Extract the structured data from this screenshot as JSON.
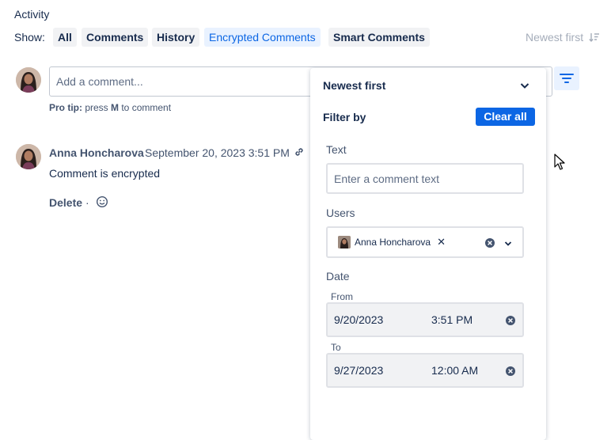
{
  "activity": {
    "heading": "Activity",
    "show_label": "Show:",
    "tabs": [
      {
        "label": "All",
        "active": false
      },
      {
        "label": "Comments",
        "active": false
      },
      {
        "label": "History",
        "active": false
      },
      {
        "label": "Encrypted Comments",
        "active": true
      },
      {
        "label": "Smart Comments",
        "active": false
      }
    ],
    "sort_label": "Newest first"
  },
  "composer": {
    "placeholder": "Add a comment...",
    "protip_prefix": "Pro tip:",
    "protip_mid": " press ",
    "protip_key": "M",
    "protip_suffix": " to comment"
  },
  "comment": {
    "author": "Anna Honcharova",
    "date": "September 20, 2023 3:51 PM",
    "body": "Comment is encrypted",
    "delete_label": "Delete",
    "separator": "·"
  },
  "filter_panel": {
    "sort_title": "Newest first",
    "filter_by": "Filter by",
    "clear_all": "Clear all",
    "text_label": "Text",
    "text_placeholder": "Enter a comment text",
    "users_label": "Users",
    "selected_user": "Anna Honcharova",
    "date_label": "Date",
    "from_label": "From",
    "from_date": "9/20/2023",
    "from_time": "3:51 PM",
    "to_label": "To",
    "to_date": "9/27/2023",
    "to_time": "12:00 AM"
  },
  "colors": {
    "accent": "#0c66e4",
    "active_tab_bg": "#e9f2ff",
    "tab_bg": "#f1f2f4",
    "text": "#172b4d",
    "subtle_text": "#44546f"
  }
}
